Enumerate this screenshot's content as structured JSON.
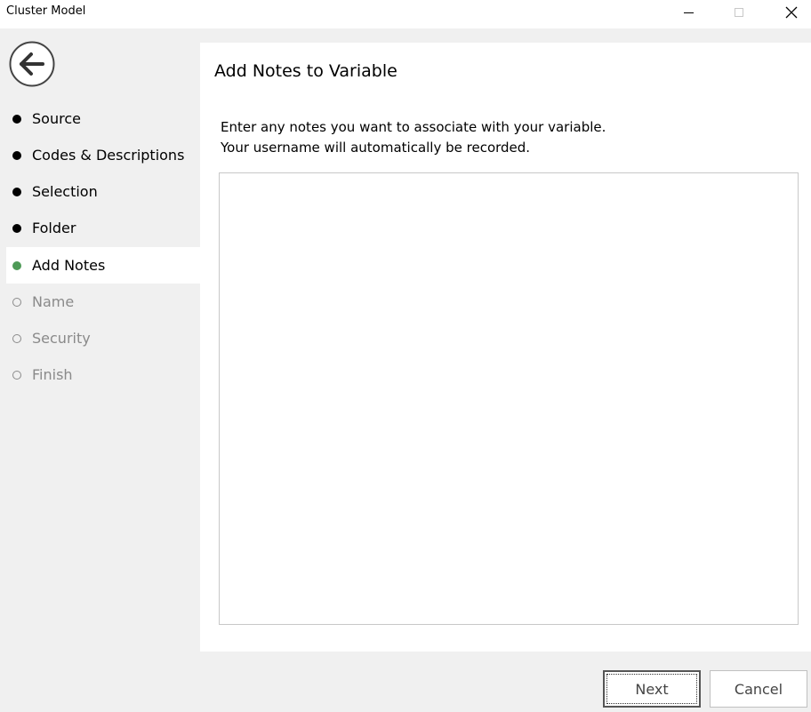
{
  "window": {
    "title": "Cluster Model"
  },
  "sidebar": {
    "back_icon": "arrow-left-circle-icon",
    "steps": [
      {
        "label": "Source",
        "state": "done"
      },
      {
        "label": "Codes & Descriptions",
        "state": "done"
      },
      {
        "label": "Selection",
        "state": "done"
      },
      {
        "label": "Folder",
        "state": "done"
      },
      {
        "label": "Add Notes",
        "state": "current"
      },
      {
        "label": "Name",
        "state": "pending"
      },
      {
        "label": "Security",
        "state": "pending"
      },
      {
        "label": "Finish",
        "state": "pending"
      }
    ]
  },
  "main": {
    "heading": "Add Notes to Variable",
    "instruction_line1": "Enter any notes you want to associate with your variable.",
    "instruction_line2": "Your username will automatically be recorded.",
    "notes_value": ""
  },
  "footer": {
    "next_label": "Next",
    "cancel_label": "Cancel"
  },
  "colors": {
    "current_step": "#4e9a57",
    "done_step": "#000000",
    "pending_step": "#8a8a8a",
    "sidebar_bg": "#f0f0f0"
  }
}
